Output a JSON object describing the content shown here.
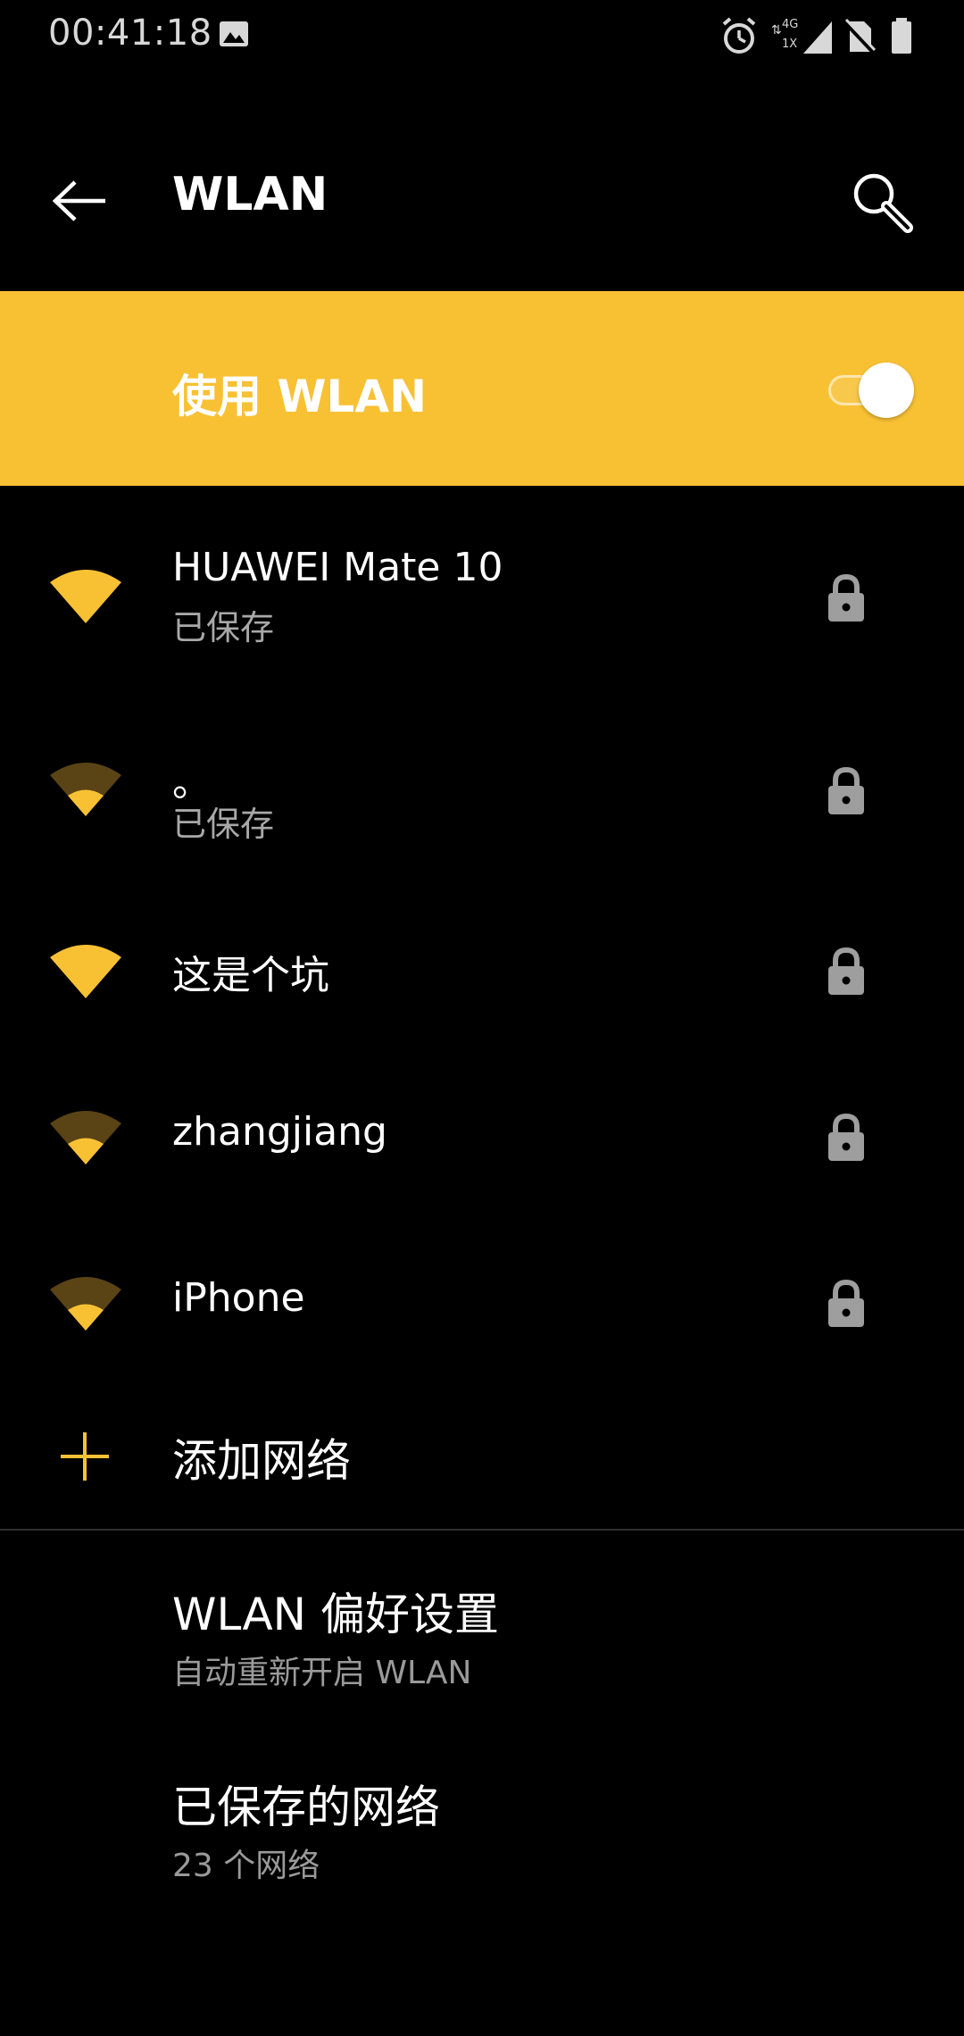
{
  "status_bar": {
    "time": "00:41:18",
    "network_type_top": "4G",
    "network_type_bottom": "1X",
    "icons": [
      "gallery-icon",
      "alarm-icon",
      "signal-icon",
      "no-sim-icon",
      "battery-icon"
    ]
  },
  "app_bar": {
    "title": "WLAN",
    "back_icon": "back-arrow-icon",
    "search_icon": "search-icon"
  },
  "master_switch": {
    "label": "使用 WLAN",
    "state": "on"
  },
  "networks": [
    {
      "name": "HUAWEI Mate 10",
      "status": "已保存",
      "signal": "full",
      "secured": true
    },
    {
      "name": "。",
      "status": "已保存",
      "signal": "weak",
      "secured": true
    },
    {
      "name": "这是个坑",
      "status": "",
      "signal": "full",
      "secured": true
    },
    {
      "name": "zhangjiang",
      "status": "",
      "signal": "weak",
      "secured": true
    },
    {
      "name": "iPhone",
      "status": "",
      "signal": "weak",
      "secured": true
    }
  ],
  "add_network": {
    "label": "添加网络"
  },
  "preferences": {
    "title": "WLAN 偏好设置",
    "subtitle": "自动重新开启 WLAN"
  },
  "saved_networks": {
    "title": "已保存的网络",
    "subtitle": "23 个网络"
  },
  "colors": {
    "accent": "#f8c134",
    "background": "#000000",
    "text_primary": "#ffffff",
    "text_secondary": "#a8a8a8",
    "icon_gray": "#9e9e9e"
  }
}
